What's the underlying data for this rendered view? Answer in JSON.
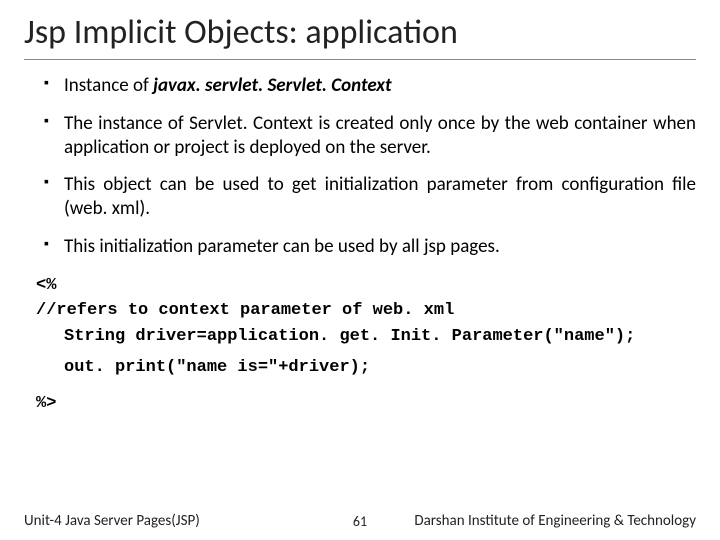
{
  "title": "Jsp Implicit Objects: application",
  "bullets": {
    "b1_pre": "Instance of ",
    "b1_em": "javax. servlet. Servlet. Context",
    "b2": "The instance of Servlet. Context is created only once by the web container when application or project is deployed on the server.",
    "b3": "This object can be used to get initialization parameter from configuration file (web. xml).",
    "b4": "This initialization parameter can be used by all jsp pages."
  },
  "code": {
    "l1": "<%",
    "l2": "//refers to context parameter of web. xml",
    "l3": "String driver=application. get. Init. Parameter(\"name\");",
    "l4": "out. print(\"name is=\"+driver);",
    "l5": "%>"
  },
  "footer": {
    "left": "Unit-4 Java Server Pages(JSP)",
    "center": "61",
    "right": "Darshan Institute of Engineering & Technology"
  }
}
